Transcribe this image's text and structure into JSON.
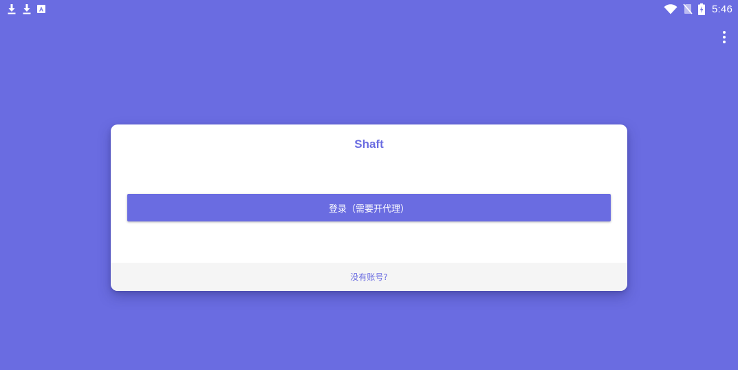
{
  "status_bar": {
    "left_icons": [
      "download-icon",
      "download-icon",
      "app-notification-icon"
    ],
    "right_icons": [
      "wifi-icon",
      "no-sim-icon",
      "battery-charging-icon"
    ],
    "time": "5:46"
  },
  "toolbar": {
    "menu_icon": "more-vert-icon"
  },
  "card": {
    "title": "Shaft",
    "login_button_label": "登录（需要开代理）",
    "signup_link_label": "没有账号?"
  },
  "colors": {
    "background": "#6a6ce1",
    "accent": "#6a6ce1",
    "card": "#ffffff",
    "footer": "#f5f5f5"
  }
}
